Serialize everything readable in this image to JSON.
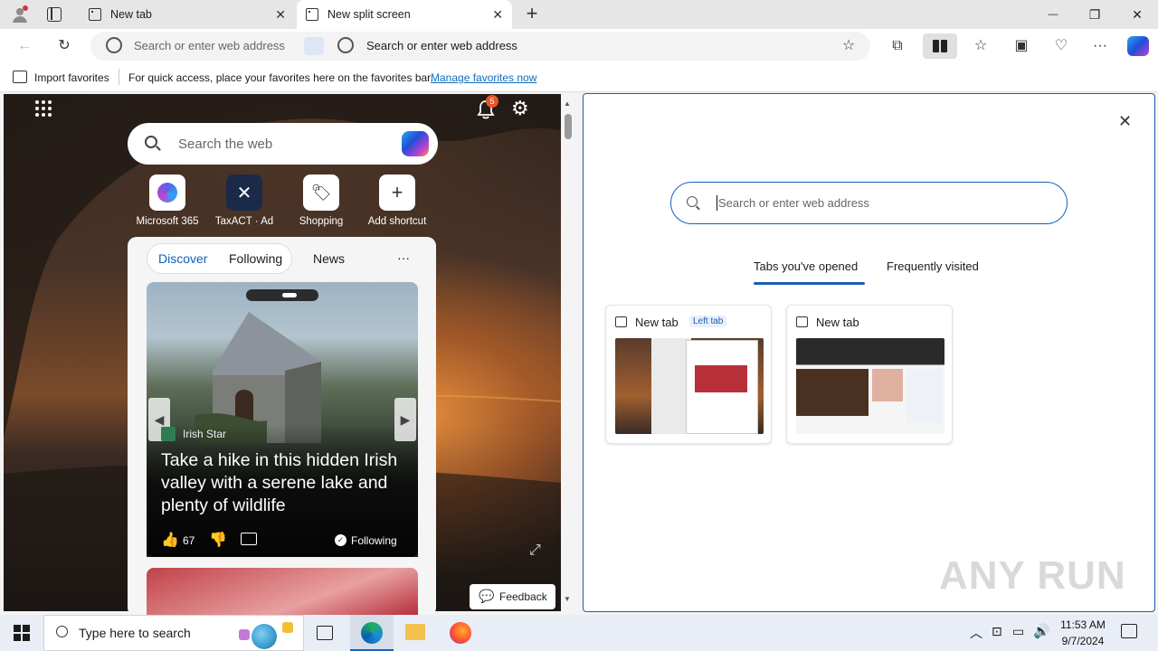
{
  "browser": {
    "tabs": [
      {
        "title": "New tab",
        "active": false
      },
      {
        "title": "New split screen",
        "active": true
      }
    ],
    "new_tab_symbol": "+",
    "window_controls": {
      "minimize": "—",
      "restore": "❐",
      "close": "✕"
    },
    "address_left_placeholder": "Search or enter web address",
    "address_right_placeholder": "Search or enter web address",
    "favbar": {
      "import_label": "Import favorites",
      "hint": "For quick access, place your favorites here on the favorites bar.",
      "manage_link": "Manage favorites now"
    }
  },
  "left_pane": {
    "notification_count": "5",
    "search_placeholder": "Search the web",
    "shortcuts": [
      {
        "label": "Microsoft 365",
        "icon": "microsoft-365-icon"
      },
      {
        "label": "TaxACT · Ad",
        "icon": "taxact-icon"
      },
      {
        "label": "Shopping",
        "icon": "shopping-tag-icon"
      },
      {
        "label": "Add shortcut",
        "icon": "plus-icon"
      }
    ],
    "feed_tabs": [
      "Discover",
      "Following",
      "News"
    ],
    "feed_more": "···",
    "card": {
      "source": "Irish Star",
      "headline": "Take a hike in this hidden Irish valley with a serene lake and plenty of wildlife",
      "likes": "67",
      "following_label": "Following"
    },
    "feedback_label": "Feedback"
  },
  "right_pane": {
    "search_placeholder": "Search or enter web address",
    "tabs": [
      "Tabs you've opened",
      "Frequently visited"
    ],
    "opened_tabs": [
      {
        "title": "New tab",
        "badge": "Left tab"
      },
      {
        "title": "New tab",
        "badge": ""
      }
    ]
  },
  "taskbar": {
    "search_placeholder": "Type here to search",
    "time": "11:53 AM",
    "date": "9/7/2024"
  },
  "watermark": "ANY RUN",
  "colors": {
    "accent": "#1a5fb4",
    "link": "#0f6cbd",
    "notification_badge": "#e8562a"
  }
}
